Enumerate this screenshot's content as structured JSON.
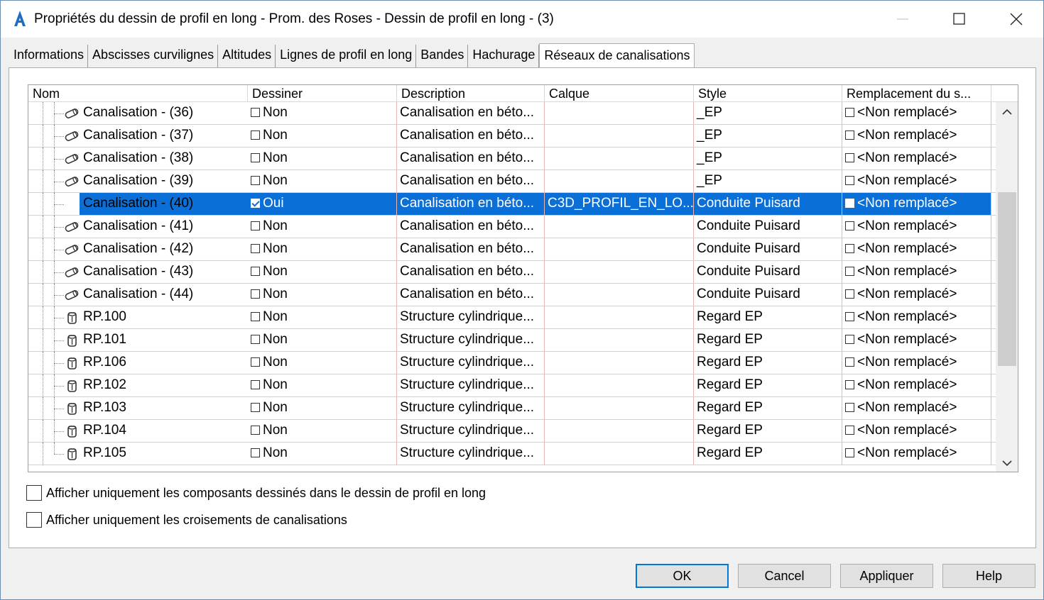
{
  "window": {
    "title": "Propriétés du dessin de profil en long - Prom. des Roses - Dessin de profil en long - (3)"
  },
  "tabs": [
    {
      "label": "Informations",
      "active": false
    },
    {
      "label": "Abscisses curvilignes",
      "active": false
    },
    {
      "label": "Altitudes",
      "active": false
    },
    {
      "label": "Lignes de profil en long",
      "active": false
    },
    {
      "label": "Bandes",
      "active": false
    },
    {
      "label": "Hachurage",
      "active": false
    },
    {
      "label": "Réseaux de canalisations",
      "active": true
    }
  ],
  "grid": {
    "columns": [
      "Nom",
      "Dessiner",
      "Description",
      "Calque",
      "Style",
      "Remplacement du s..."
    ],
    "rows": [
      {
        "icon": "pipe-icon",
        "name": "Canalisation - (36)",
        "draw": "Non",
        "checked": false,
        "description": "Canalisation en béto...",
        "layer": "",
        "style": "_EP",
        "override": "<Non remplacé>",
        "selected": false
      },
      {
        "icon": "pipe-icon",
        "name": "Canalisation - (37)",
        "draw": "Non",
        "checked": false,
        "description": "Canalisation en béto...",
        "layer": "",
        "style": "_EP",
        "override": "<Non remplacé>",
        "selected": false
      },
      {
        "icon": "pipe-icon",
        "name": "Canalisation - (38)",
        "draw": "Non",
        "checked": false,
        "description": "Canalisation en béto...",
        "layer": "",
        "style": "_EP",
        "override": "<Non remplacé>",
        "selected": false
      },
      {
        "icon": "pipe-icon",
        "name": "Canalisation - (39)",
        "draw": "Non",
        "checked": false,
        "description": "Canalisation en béto...",
        "layer": "",
        "style": "_EP",
        "override": "<Non remplacé>",
        "selected": false
      },
      {
        "icon": "pipe-icon",
        "name": "Canalisation - (40)",
        "draw": "Oui",
        "checked": true,
        "description": "Canalisation en béto...",
        "layer": "C3D_PROFIL_EN_LO...",
        "style": "Conduite Puisard",
        "override": "<Non remplacé>",
        "selected": true
      },
      {
        "icon": "pipe-icon",
        "name": "Canalisation - (41)",
        "draw": "Non",
        "checked": false,
        "description": "Canalisation en béto...",
        "layer": "",
        "style": "Conduite Puisard",
        "override": "<Non remplacé>",
        "selected": false
      },
      {
        "icon": "pipe-icon",
        "name": "Canalisation - (42)",
        "draw": "Non",
        "checked": false,
        "description": "Canalisation en béto...",
        "layer": "",
        "style": "Conduite Puisard",
        "override": "<Non remplacé>",
        "selected": false
      },
      {
        "icon": "pipe-icon",
        "name": "Canalisation - (43)",
        "draw": "Non",
        "checked": false,
        "description": "Canalisation en béto...",
        "layer": "",
        "style": "Conduite Puisard",
        "override": "<Non remplacé>",
        "selected": false
      },
      {
        "icon": "pipe-icon",
        "name": "Canalisation - (44)",
        "draw": "Non",
        "checked": false,
        "description": "Canalisation en béto...",
        "layer": "",
        "style": "Conduite Puisard",
        "override": "<Non remplacé>",
        "selected": false
      },
      {
        "icon": "structure-icon",
        "name": "RP.100",
        "draw": "Non",
        "checked": false,
        "description": "Structure cylindrique...",
        "layer": "",
        "style": "Regard EP",
        "override": "<Non remplacé>",
        "selected": false
      },
      {
        "icon": "structure-icon",
        "name": "RP.101",
        "draw": "Non",
        "checked": false,
        "description": "Structure cylindrique...",
        "layer": "",
        "style": "Regard EP",
        "override": "<Non remplacé>",
        "selected": false
      },
      {
        "icon": "structure-icon",
        "name": "RP.106",
        "draw": "Non",
        "checked": false,
        "description": "Structure cylindrique...",
        "layer": "",
        "style": "Regard EP",
        "override": "<Non remplacé>",
        "selected": false
      },
      {
        "icon": "structure-icon",
        "name": "RP.102",
        "draw": "Non",
        "checked": false,
        "description": "Structure cylindrique...",
        "layer": "",
        "style": "Regard EP",
        "override": "<Non remplacé>",
        "selected": false
      },
      {
        "icon": "structure-icon",
        "name": "RP.103",
        "draw": "Non",
        "checked": false,
        "description": "Structure cylindrique...",
        "layer": "",
        "style": "Regard EP",
        "override": "<Non remplacé>",
        "selected": false
      },
      {
        "icon": "structure-icon",
        "name": "RP.104",
        "draw": "Non",
        "checked": false,
        "description": "Structure cylindrique...",
        "layer": "",
        "style": "Regard EP",
        "override": "<Non remplacé>",
        "selected": false
      },
      {
        "icon": "structure-icon",
        "name": "RP.105",
        "draw": "Non",
        "checked": false,
        "description": "Structure cylindrique...",
        "layer": "",
        "style": "Regard EP",
        "override": "<Non remplacé>",
        "selected": false
      }
    ],
    "scroll_position": 0.45
  },
  "options": {
    "show_drawn_only": "Afficher uniquement les composants dessinés dans le dessin de profil en long",
    "show_crossings_only": "Afficher uniquement les croisements de canalisations"
  },
  "buttons": {
    "ok": "OK",
    "cancel": "Cancel",
    "apply": "Appliquer",
    "help": "Help"
  },
  "colors": {
    "selection": "#0a6fd6",
    "app_icon": "#1d6ec0",
    "default_button_border": "#0078d7"
  }
}
